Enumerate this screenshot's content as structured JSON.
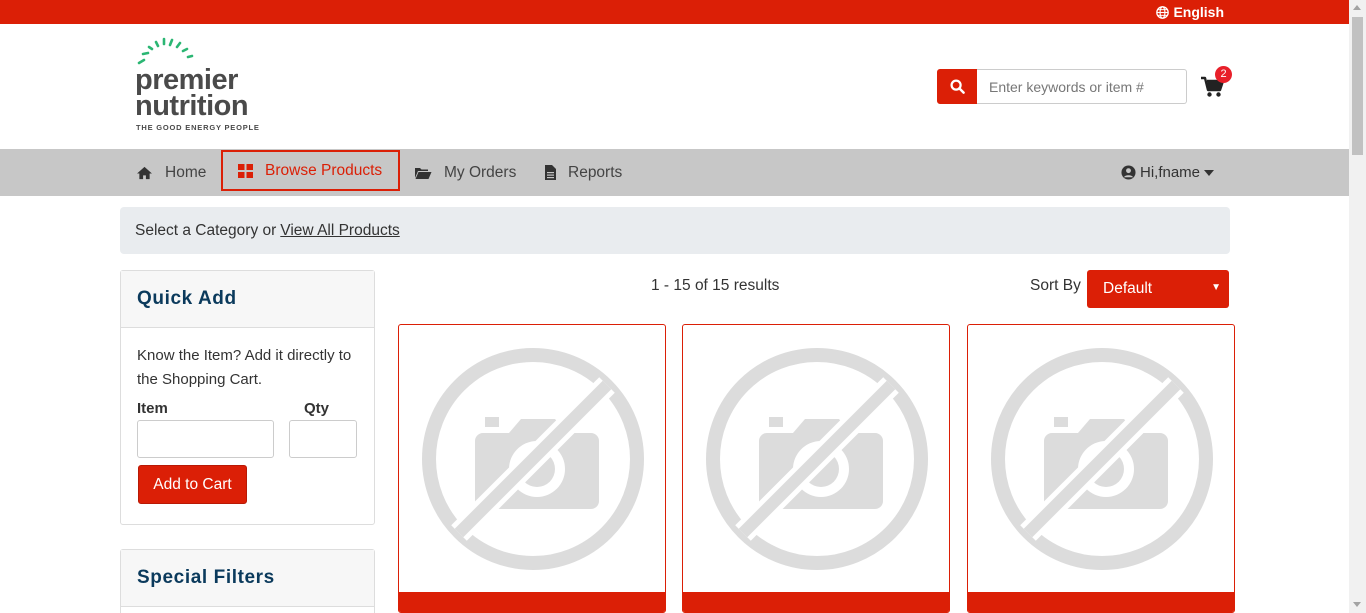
{
  "topbar": {
    "language": "English",
    "icon": "globe-icon"
  },
  "logo": {
    "line1": "premier",
    "line2": "nutrition",
    "tagline": "THE GOOD ENERGY PEOPLE"
  },
  "search": {
    "placeholder": "Enter keywords or item #",
    "value": "",
    "icon": "search-icon"
  },
  "cart": {
    "count": "2",
    "icon": "cart-icon"
  },
  "nav": {
    "items": [
      {
        "label": "Home",
        "icon": "home-icon"
      },
      {
        "label": "Browse Products",
        "icon": "grid-icon",
        "active": true
      },
      {
        "label": "My Orders",
        "icon": "folder-open-icon"
      },
      {
        "label": "Reports",
        "icon": "file-icon"
      }
    ],
    "user": "Hi,fname",
    "user_icon": "user-circle-icon"
  },
  "breadcrumb": {
    "prefix": "Select a Category or",
    "link": "View All Products"
  },
  "quick_add": {
    "title": "Quick Add",
    "description": "Know the Item? Add it directly to the Shopping Cart.",
    "item_label": "Item",
    "qty_label": "Qty",
    "item_value": "",
    "qty_value": "",
    "button": "Add to Cart"
  },
  "special_filters": {
    "title": "Special Filters"
  },
  "results": {
    "text": "1 - 15 of 15 results"
  },
  "sort": {
    "label": "Sort By",
    "selected": "Default"
  },
  "products": [
    {
      "image": "no-image-icon"
    },
    {
      "image": "no-image-icon"
    },
    {
      "image": "no-image-icon"
    }
  ],
  "colors": {
    "brand": "#db1f06",
    "nav_bg": "#c7c7c7",
    "heading": "#0b3a5c",
    "logo_green": "#2bb673"
  }
}
